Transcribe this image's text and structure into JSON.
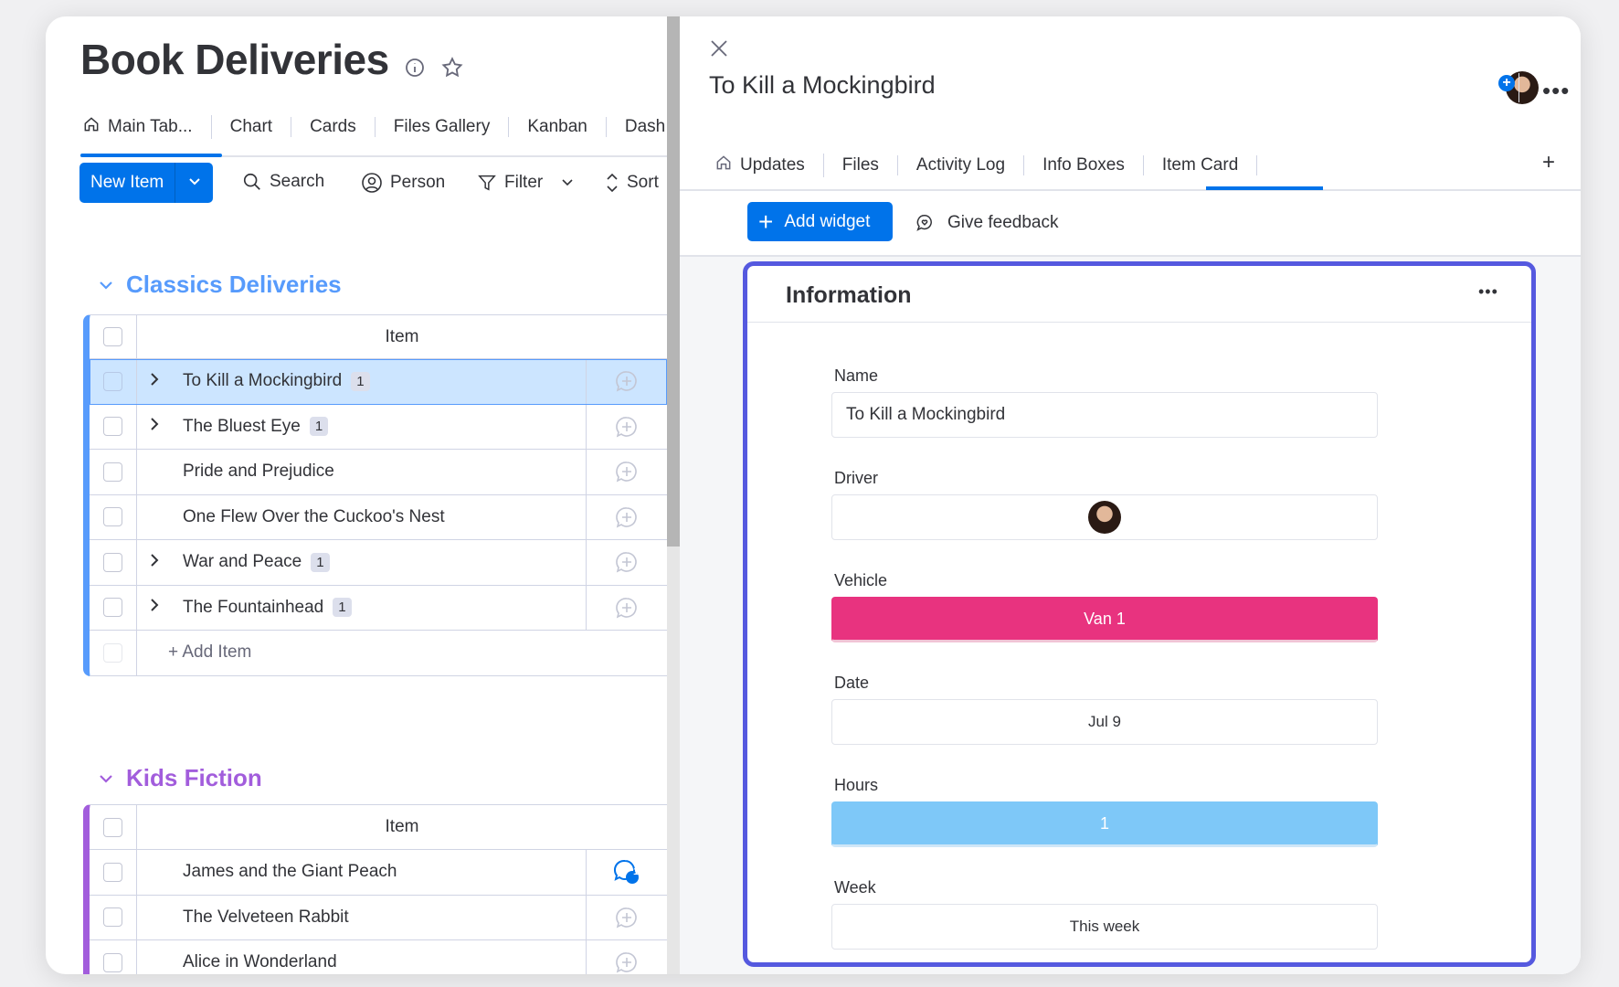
{
  "board": {
    "title": "Book Deliveries",
    "views": [
      "Main Tab...",
      "Chart",
      "Cards",
      "Files Gallery",
      "Kanban",
      "Dash"
    ],
    "toolbar": {
      "new_item": "New Item",
      "search": "Search",
      "person": "Person",
      "filter": "Filter",
      "sort": "Sort"
    },
    "groups": [
      {
        "title": "Classics Deliveries",
        "color": "#579bfc",
        "header": "Item",
        "items": [
          {
            "name": "To Kill a Mockingbird",
            "subitems": "1",
            "selected": true
          },
          {
            "name": "The Bluest Eye",
            "subitems": "1"
          },
          {
            "name": "Pride and Prejudice"
          },
          {
            "name": "One Flew Over the Cuckoo's Nest"
          },
          {
            "name": "War and Peace",
            "subitems": "1"
          },
          {
            "name": "The Fountainhead",
            "subitems": "1"
          }
        ],
        "add_item": "+ Add Item"
      },
      {
        "title": "Kids Fiction",
        "color": "#a25ddc",
        "header": "Item",
        "items": [
          {
            "name": "James and the Giant Peach",
            "updates": "1"
          },
          {
            "name": "The Velveteen Rabbit"
          },
          {
            "name": "Alice in Wonderland"
          }
        ]
      }
    ]
  },
  "panel": {
    "title": "To Kill a Mockingbird",
    "tabs": [
      "Updates",
      "Files",
      "Activity Log",
      "Info Boxes",
      "Item Card"
    ],
    "active_tab": "Item Card",
    "add_widget": "Add widget",
    "give_feedback": "Give feedback",
    "widget": {
      "title": "Information",
      "fields": {
        "name": {
          "label": "Name",
          "value": "To Kill a Mockingbird"
        },
        "driver": {
          "label": "Driver"
        },
        "vehicle": {
          "label": "Vehicle",
          "value": "Van 1",
          "color": "#e8337f"
        },
        "date": {
          "label": "Date",
          "value": "Jul 9"
        },
        "hours": {
          "label": "Hours",
          "value": "1",
          "color": "#7ec8f8"
        },
        "week": {
          "label": "Week",
          "value": "This week"
        }
      }
    }
  },
  "colors": {
    "primary": "#0073ea",
    "widget_border": "#5559df",
    "selected_row": "#cce5ff"
  }
}
